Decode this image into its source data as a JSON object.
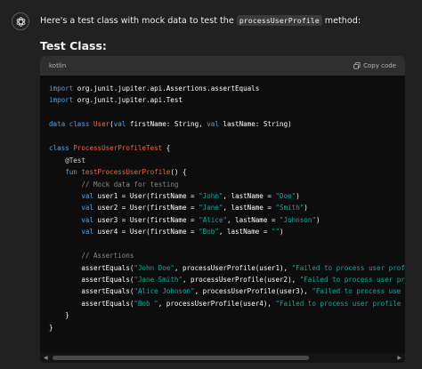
{
  "message": {
    "intro_before": "Here's a test class with mock data to test the ",
    "inline_code": "processUserProfile",
    "intro_after": " method:",
    "heading": "Test Class:"
  },
  "code_block": {
    "language": "kotlin",
    "copy_label": "Copy code",
    "lines": [
      [
        {
          "t": "import",
          "c": "kw"
        },
        {
          "t": " org.junit.jupiter.api.Assertions.assertEquals"
        }
      ],
      [
        {
          "t": "import",
          "c": "kw"
        },
        {
          "t": " org.junit.jupiter.api.Test"
        }
      ],
      [],
      [
        {
          "t": "data class",
          "c": "kw"
        },
        {
          "t": " "
        },
        {
          "t": "User",
          "c": "cls"
        },
        {
          "t": "("
        },
        {
          "t": "val",
          "c": "kw"
        },
        {
          "t": " firstName: String, "
        },
        {
          "t": "val",
          "c": "kw"
        },
        {
          "t": " lastName: String)"
        }
      ],
      [],
      [
        {
          "t": "class",
          "c": "kw"
        },
        {
          "t": " "
        },
        {
          "t": "ProcessUserProfileTest",
          "c": "cls"
        },
        {
          "t": " {"
        }
      ],
      [
        {
          "t": "    "
        },
        {
          "t": "@Test",
          "c": "annot"
        }
      ],
      [
        {
          "t": "    "
        },
        {
          "t": "fun",
          "c": "kw"
        },
        {
          "t": " "
        },
        {
          "t": "testProcessUserProfile",
          "c": "cls"
        },
        {
          "t": "() {"
        }
      ],
      [
        {
          "t": "        "
        },
        {
          "t": "// Mock data for testing",
          "c": "cmt"
        }
      ],
      [
        {
          "t": "        "
        },
        {
          "t": "val",
          "c": "kw"
        },
        {
          "t": " user1 = User(firstName = "
        },
        {
          "t": "\"John\"",
          "c": "str"
        },
        {
          "t": ", lastName = "
        },
        {
          "t": "\"Doe\"",
          "c": "str"
        },
        {
          "t": ")"
        }
      ],
      [
        {
          "t": "        "
        },
        {
          "t": "val",
          "c": "kw"
        },
        {
          "t": " user2 = User(firstName = "
        },
        {
          "t": "\"Jane\"",
          "c": "str"
        },
        {
          "t": ", lastName = "
        },
        {
          "t": "\"Smith\"",
          "c": "str"
        },
        {
          "t": ")"
        }
      ],
      [
        {
          "t": "        "
        },
        {
          "t": "val",
          "c": "kw"
        },
        {
          "t": " user3 = User(firstName = "
        },
        {
          "t": "\"Alice\"",
          "c": "str"
        },
        {
          "t": ", lastName = "
        },
        {
          "t": "\"Johnson\"",
          "c": "str"
        },
        {
          "t": ")"
        }
      ],
      [
        {
          "t": "        "
        },
        {
          "t": "val",
          "c": "kw"
        },
        {
          "t": " user4 = User(firstName = "
        },
        {
          "t": "\"Bob\"",
          "c": "str"
        },
        {
          "t": ", lastName = "
        },
        {
          "t": "\"\"",
          "c": "str"
        },
        {
          "t": ")"
        }
      ],
      [],
      [
        {
          "t": "        "
        },
        {
          "t": "// Assertions",
          "c": "cmt"
        }
      ],
      [
        {
          "t": "        assertEquals("
        },
        {
          "t": "\"John Doe\"",
          "c": "str"
        },
        {
          "t": ", processUserProfile(user1), "
        },
        {
          "t": "\"Failed to process user profile",
          "c": "str"
        }
      ],
      [
        {
          "t": "        assertEquals("
        },
        {
          "t": "\"Jane Smith\"",
          "c": "str"
        },
        {
          "t": ", processUserProfile(user2), "
        },
        {
          "t": "\"Failed to process user prof",
          "c": "str"
        }
      ],
      [
        {
          "t": "        assertEquals("
        },
        {
          "t": "\"Alice Johnson\"",
          "c": "str"
        },
        {
          "t": ", processUserProfile(user3), "
        },
        {
          "t": "\"Failed to process use",
          "c": "str"
        }
      ],
      [
        {
          "t": "        assertEquals("
        },
        {
          "t": "\"Bob \"",
          "c": "str"
        },
        {
          "t": ", processUserProfile(user4), "
        },
        {
          "t": "\"Failed to process user profile fo",
          "c": "str"
        }
      ],
      [
        {
          "t": "    }"
        }
      ],
      [
        {
          "t": "}"
        }
      ]
    ]
  },
  "colors": {
    "background": "#212121",
    "code_background": "#0d0d0d",
    "keyword": "#4aa5f0",
    "class_name": "#f0683c",
    "string": "#00b0a0",
    "comment": "#8a8a8a"
  },
  "icons": {
    "avatar": "openai-logo-icon",
    "copy": "copy-icon"
  }
}
